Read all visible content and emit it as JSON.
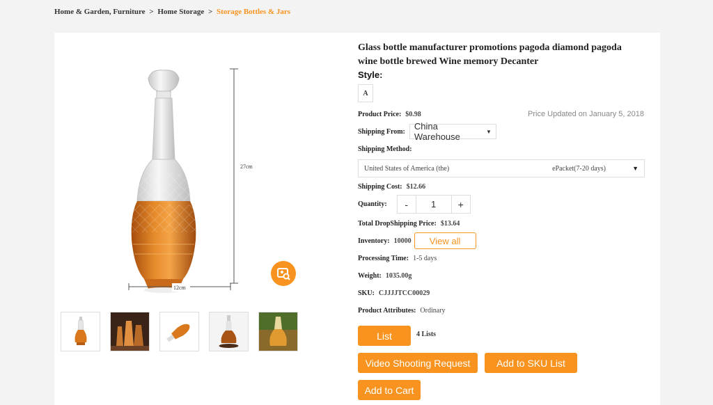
{
  "breadcrumb": {
    "item1": "Home & Garden, Furniture",
    "sep1": ">",
    "item2": "Home Storage",
    "sep2": ">",
    "current": "Storage Bottles & Jars"
  },
  "gallery": {
    "dimension_height": "27cm",
    "dimension_width": "12cm",
    "thumbnail_count": 5
  },
  "product": {
    "title": "Glass bottle manufacturer promotions pagoda diamond pagoda wine bottle brewed Wine memory Decanter",
    "style_label": "Style:",
    "style_option": "A",
    "price_label": "Product Price:",
    "price_value": "$0.98",
    "price_updated": "Price Updated on January 5, 2018",
    "ship_from_label": "Shipping From:",
    "ship_from_value": "China Warehouse",
    "ship_method_label": "Shipping Method:",
    "ship_country": "United States of America (the)",
    "ship_method": "ePacket(7-20 days)",
    "ship_cost_label": "Shipping Cost:",
    "ship_cost_value": "$12.66",
    "quantity_label": "Quantity:",
    "quantity_minus": "-",
    "quantity_value": "1",
    "quantity_plus": "+",
    "total_label": "Total DropShipping Price:",
    "total_value": "$13.64",
    "inventory_label": "Inventory:",
    "inventory_value": "10000",
    "view_all": "View all",
    "processing_label": "Processing Time:",
    "processing_value": "1-5 days",
    "weight_label": "Weight:",
    "weight_value": "1035.00g",
    "sku_label": "SKU:",
    "sku_value": "CJJJJTCC00029",
    "attributes_label": "Product Attributes:",
    "attributes_value": "Ordinary"
  },
  "actions": {
    "list": "List",
    "lists_count": "4 Lists",
    "video_request": "Video Shooting Request",
    "add_sku": "Add to SKU List",
    "add_cart": "Add to Cart"
  },
  "colors": {
    "accent": "#f7931e",
    "amber_liquid": "#d9781c"
  }
}
